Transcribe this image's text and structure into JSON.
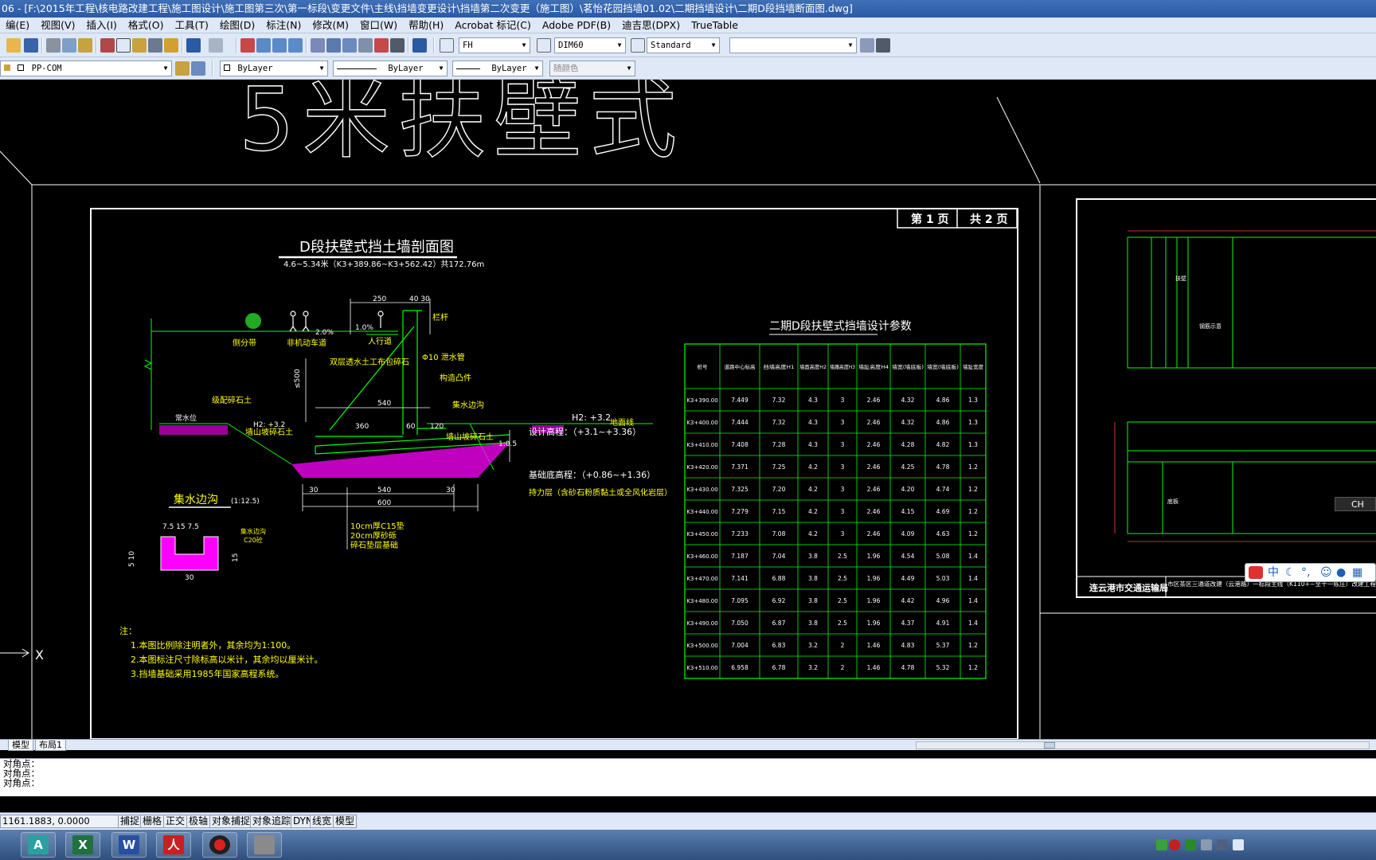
{
  "window": {
    "title": "06 - [F:\\2015年工程\\核电路改建工程\\施工图设计\\施工图第三次\\第一标段\\变更文件\\主线\\挡墙变更设计\\挡墙第二次变更（施工图）\\茗怡花园挡墙01.02\\二期挡墙设计\\二期D段挡墙断面图.dwg]"
  },
  "menu": [
    "编(E)",
    "视图(V)",
    "插入(I)",
    "格式(O)",
    "工具(T)",
    "绘图(D)",
    "标注(N)",
    "修改(M)",
    "窗口(W)",
    "帮助(H)",
    "Acrobat 标记(C)",
    "Adobe PDF(B)",
    "迪吉思(DPX)",
    "TrueTable"
  ],
  "toolbar": {
    "text_style": "FH",
    "dim_style": "DIM60",
    "table_style": "Standard",
    "layer": "PP-COM",
    "color": "ByLayer",
    "linetype": "ByLayer",
    "lineweight": "ByLayer",
    "plot_style": "随颜色"
  },
  "colors": {
    "accent": "#2b5aa5",
    "chrome": "#dfe8f6",
    "cad_white": "#ffffff",
    "cad_yellow": "#ffff00",
    "cad_green": "#00ff00",
    "cad_magenta": "#ff00ff",
    "cad_cyan": "#00ffff"
  },
  "drawing": {
    "big_title": "5米扶壁式",
    "page_info": {
      "page": "第 1 页",
      "total": "共 2 页"
    },
    "section_title": "D段扶壁式挡土墙剖面图",
    "section_subtitle": "4.6~5.34米（K3+389.86~K3+562.42）共172.76m",
    "labels": {
      "green_belt": "侧分带",
      "nonmotor_lane": "非机动车道",
      "sidewalk": "人行道",
      "railing": "栏杆",
      "slope1": "2.0%",
      "slope2": "1.0%",
      "drain_pipe": "Φ10 泄水管",
      "fill_layer": "级配碎石土",
      "fill_layer2": "墙山坡碎石土",
      "geotextile": "双层透水土工布包碎石",
      "joint": "构造凸件",
      "catch_ditch": "集水边沟",
      "dim_250": "250",
      "dim_4030": "40 30",
      "dim_540": "540",
      "dim_360": "360",
      "dim_30a": "30",
      "dim_30b": "30",
      "dim_540b": "540",
      "dim_600": "600",
      "dim_500": "≤500",
      "dim_60": "60",
      "dim_120": "120",
      "dim_1": "1",
      "dim_ratio": "1:0.5",
      "water_level": "H2: +3.2",
      "water_level_left": "H2: +3.2",
      "ground_line": "地面线",
      "riverbed": "常水位",
      "elev_design": "设计高程：（+3.1~+3.36）",
      "elev_base": "基础底高程：（+0.86~+1.36）",
      "bearing": "持力层（含砂石粉质黏土或全风化岩层）",
      "bedding1": "10cm厚C15垫",
      "bedding2": "20cm厚砂砾",
      "bedding3": "碎石垫层基础",
      "ditch_title": "集水边沟",
      "ditch_scale": "(1:12.5)",
      "ditch_dims_top": "7.5   15   7.5",
      "ditch_dim_bottom": "30",
      "ditch_dim_left": "5 10",
      "ditch_dim_right": "15",
      "ditch_label": "集水边沟",
      "ditch_concrete": "C20砼",
      "notes_title": "注：",
      "note1": "1.本图比例除注明者外，其余均为1:100。",
      "note2": "2.本图标注尺寸除标高以米计，其余均以厘米计。",
      "note3": "3.挡墙基础采用1985年国家高程系统。"
    },
    "table": {
      "title": "二期D段扶壁式挡墙设计参数",
      "headers": [
        "桩号",
        "道路中心标高",
        "挡墙高度H1",
        "墙面高度H2",
        "墙踵高度H3",
        "墙趾高度H4",
        "墙宽(墙底板)",
        "墙宽(墙底板)",
        "墙趾宽度"
      ],
      "rows": [
        [
          "K3+390.00",
          "7.449",
          "7.32",
          "4.3",
          "3",
          "2.46",
          "4.32",
          "4.86",
          "1.3"
        ],
        [
          "K3+400.00",
          "7.444",
          "7.32",
          "4.3",
          "3",
          "2.46",
          "4.32",
          "4.86",
          "1.3"
        ],
        [
          "K3+410.00",
          "7.408",
          "7.28",
          "4.3",
          "3",
          "2.46",
          "4.28",
          "4.82",
          "1.3"
        ],
        [
          "K3+420.00",
          "7.371",
          "7.25",
          "4.2",
          "3",
          "2.46",
          "4.25",
          "4.78",
          "1.2"
        ],
        [
          "K3+430.00",
          "7.325",
          "7.20",
          "4.2",
          "3",
          "2.46",
          "4.20",
          "4.74",
          "1.2"
        ],
        [
          "K3+440.00",
          "7.279",
          "7.15",
          "4.2",
          "3",
          "2.46",
          "4.15",
          "4.69",
          "1.2"
        ],
        [
          "K3+450.00",
          "7.233",
          "7.08",
          "4.2",
          "3",
          "2.46",
          "4.09",
          "4.63",
          "1.2"
        ],
        [
          "K3+460.00",
          "7.187",
          "7.04",
          "3.8",
          "2.5",
          "1.96",
          "4.54",
          "5.08",
          "1.4"
        ],
        [
          "K3+470.00",
          "7.141",
          "6.88",
          "3.8",
          "2.5",
          "1.96",
          "4.49",
          "5.03",
          "1.4"
        ],
        [
          "K3+480.00",
          "7.095",
          "6.92",
          "3.8",
          "2.5",
          "1.96",
          "4.42",
          "4.96",
          "1.4"
        ],
        [
          "K3+490.00",
          "7.050",
          "6.87",
          "3.8",
          "2.5",
          "1.96",
          "4.37",
          "4.91",
          "1.4"
        ],
        [
          "K3+500.00",
          "7.004",
          "6.83",
          "3.2",
          "2",
          "1.46",
          "4.83",
          "5.37",
          "1.2"
        ],
        [
          "K3+510.00",
          "6.958",
          "6.78",
          "3.2",
          "2",
          "1.46",
          "4.78",
          "5.32",
          "1.2"
        ]
      ]
    },
    "right_sheet": {
      "org": "连云港市交通运输局",
      "project": "市区茶区三通道改建（云港路）一标段主线（K110+~至十一陈庄）改建工程",
      "label_wall": "扶壁",
      "label_rebar": "钢筋示意",
      "label_base": "底板"
    },
    "ucs_label": "X"
  },
  "tabs": [
    "模型",
    "布局1"
  ],
  "command_lines": [
    "对角点：",
    "对角点：",
    "对角点："
  ],
  "status": {
    "coords": "1161.1883, 0.0000",
    "buttons": [
      "捕捉",
      "栅格",
      "正交",
      "极轴",
      "对象捕捉",
      "对象追踪",
      "DYN",
      "线宽",
      "模型"
    ]
  },
  "ime": {
    "lang": "CH",
    "mode": "中"
  }
}
